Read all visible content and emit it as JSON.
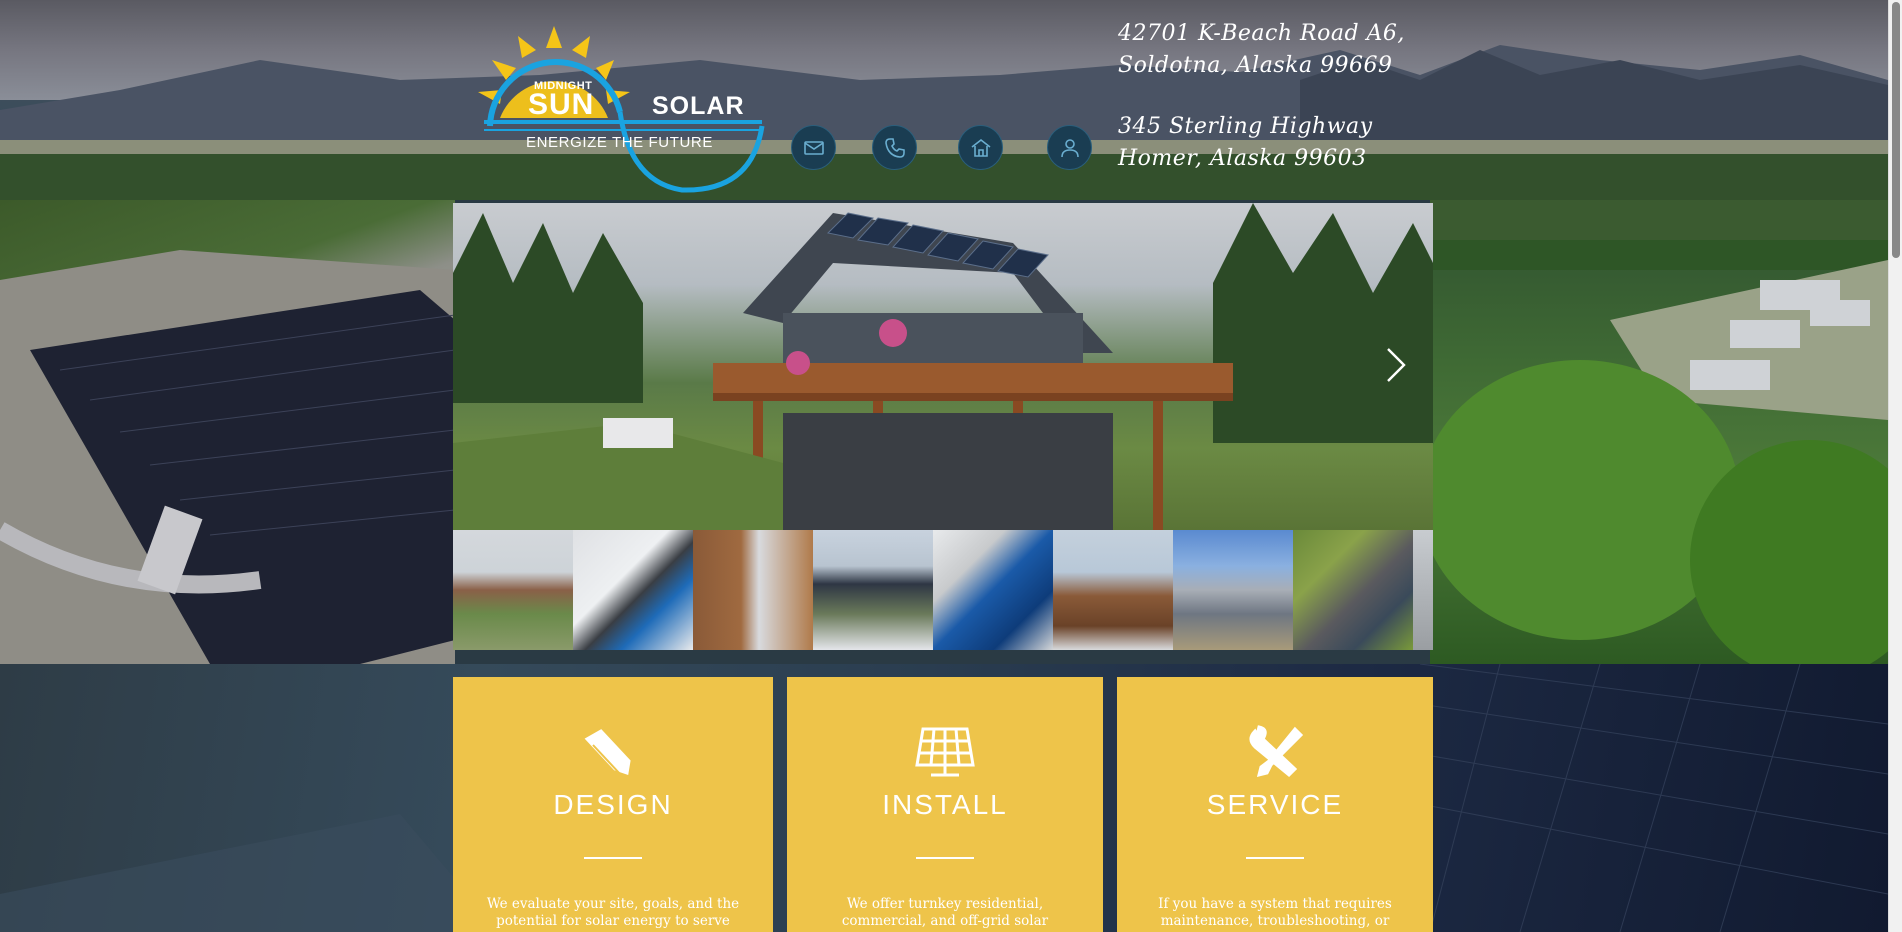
{
  "logo": {
    "line1": "MIDNIGHT",
    "line2": "SUN",
    "line3": "SOLAR",
    "tagline": "ENERGIZE THE FUTURE"
  },
  "contact_icons": [
    "mail-icon",
    "phone-icon",
    "home-icon",
    "user-icon"
  ],
  "addresses": [
    {
      "line1": "42701 K-Beach Road A6,",
      "line2": "Soldotna, Alaska 99669"
    },
    {
      "line1": "345 Sterling Highway",
      "line2": "Homer, Alaska 99603"
    }
  ],
  "services": [
    {
      "title": "DESIGN",
      "icon": "pencil-icon",
      "text": "We evaluate your site, goals, and the potential for solar energy to serve"
    },
    {
      "title": "INSTALL",
      "icon": "solar-panel-icon",
      "text": "We offer turnkey residential, commercial, and off-grid solar"
    },
    {
      "title": "SERVICE",
      "icon": "wrench-screwdriver-icon",
      "text": "If you have a system that requires maintenance, troubleshooting, or"
    }
  ],
  "colors": {
    "card": "#eec44a",
    "icon_bg": "#1a3d52",
    "icon_stroke": "#6aaed0",
    "logo_blue": "#1aa3e0",
    "logo_sun": "#f5c518"
  }
}
